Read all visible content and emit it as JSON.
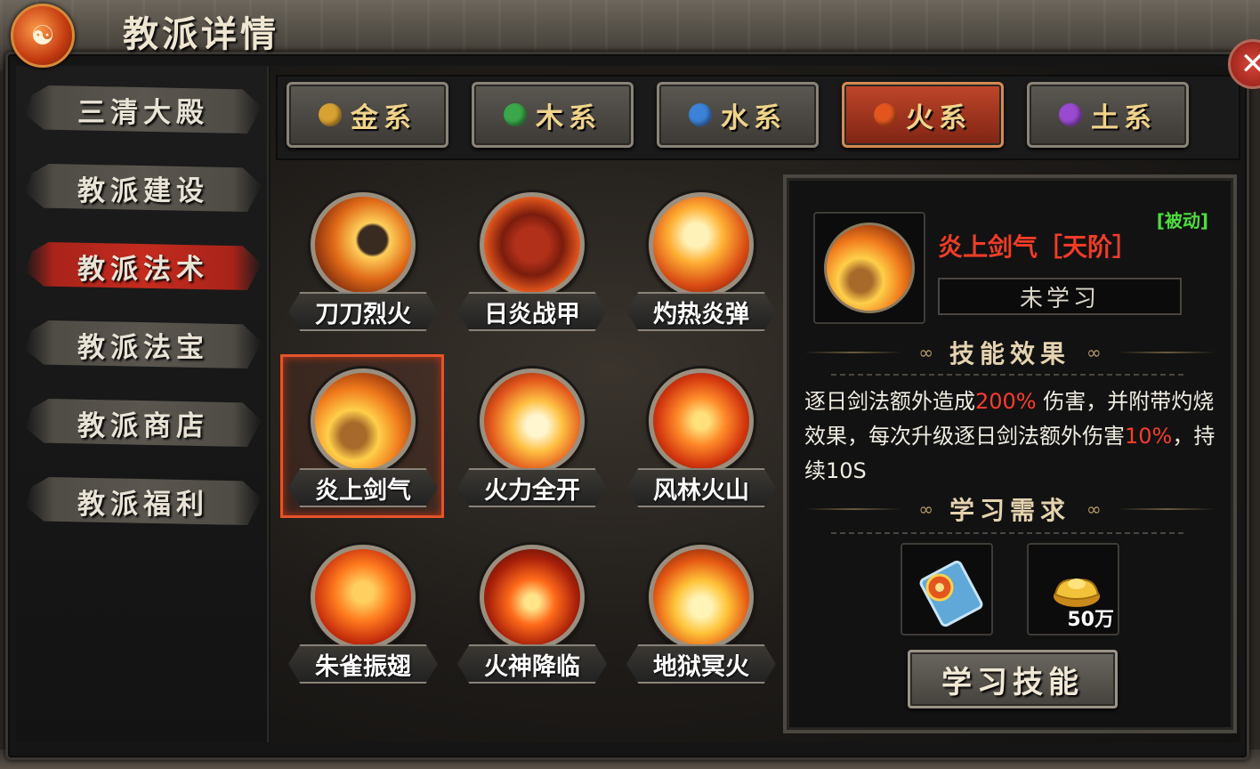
{
  "window": {
    "title": "教派详情",
    "emblem": "☯",
    "close_symbol": "✕"
  },
  "sidebar": {
    "items": [
      {
        "label": "三清大殿"
      },
      {
        "label": "教派建设"
      },
      {
        "label": "教派法术",
        "active": true
      },
      {
        "label": "教派法宝"
      },
      {
        "label": "教派商店"
      },
      {
        "label": "教派福利"
      }
    ]
  },
  "tabs": [
    {
      "label": "金系",
      "color": "#d8a232"
    },
    {
      "label": "木系",
      "color": "#3aa84a"
    },
    {
      "label": "水系",
      "color": "#3c82d8"
    },
    {
      "label": "火系",
      "color": "#e2561e",
      "active": true
    },
    {
      "label": "土系",
      "color": "#9a4ad0"
    }
  ],
  "skills": [
    {
      "label": "刀刀烈火"
    },
    {
      "label": "日炎战甲"
    },
    {
      "label": "灼热炎弹"
    },
    {
      "label": "炎上剑气",
      "selected": true
    },
    {
      "label": "火力全开"
    },
    {
      "label": "风林火山"
    },
    {
      "label": "朱雀振翅"
    },
    {
      "label": "火神降临"
    },
    {
      "label": "地狱冥火"
    }
  ],
  "detail": {
    "type": "[被动]",
    "name": "炎上剑气［天阶］",
    "status": "未学习",
    "effect_title": "技能效果",
    "description": {
      "part1": "逐日剑法额外造成",
      "value1": "200%",
      "part2": " 伤害，并附带灼烧效果，每次升级逐日剑法额外伤害",
      "value2": "10%",
      "part3": "，持续10S"
    },
    "requirement_title": "学习需求",
    "requirements": [
      {
        "icon": "skill-book-icon",
        "count": ""
      },
      {
        "icon": "gold-ingot-icon",
        "count": "50万"
      }
    ],
    "learn_button": "学习技能"
  },
  "colors": {
    "accent_red": "#c52b1f",
    "passive_green": "#4ddc3c",
    "highlight": "#ff3b2a"
  }
}
